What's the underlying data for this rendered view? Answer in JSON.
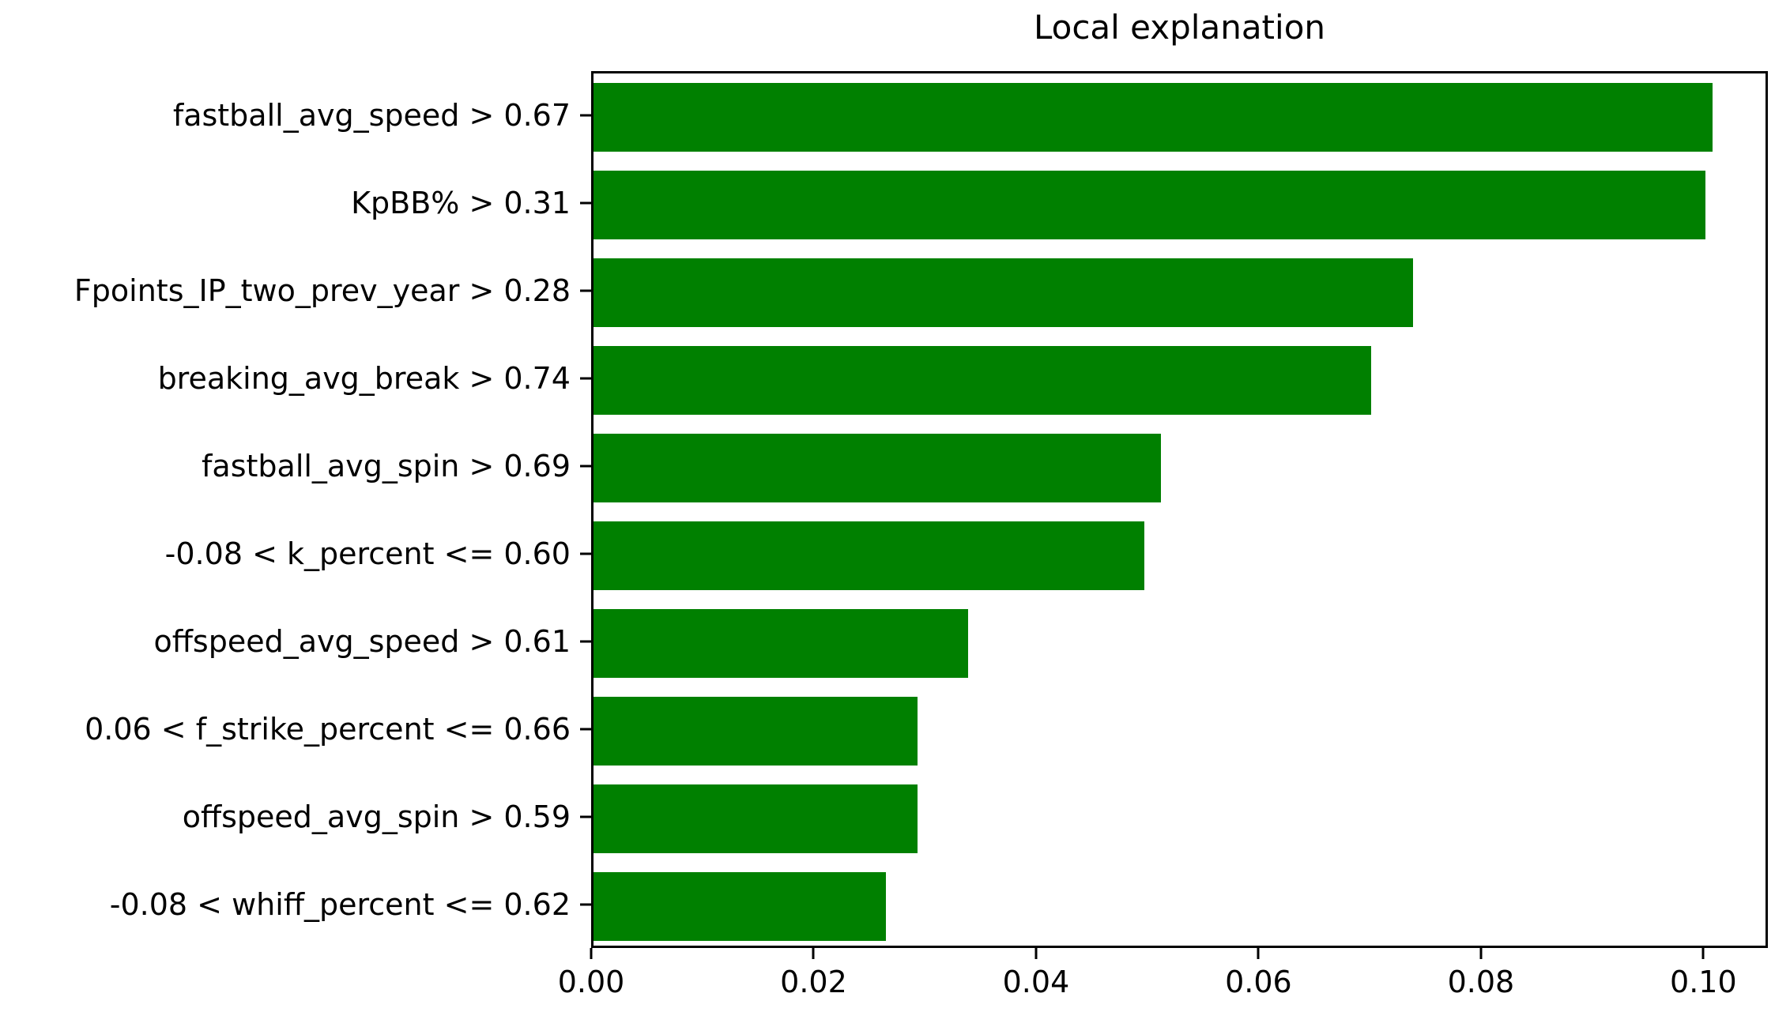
{
  "chart_data": {
    "type": "bar",
    "orientation": "horizontal",
    "title": "Local explanation",
    "xlabel": "",
    "ylabel": "",
    "categories": [
      "fastball_avg_speed > 0.67",
      "KpBB% > 0.31",
      "Fpoints_IP_two_prev_year > 0.28",
      "breaking_avg_break > 0.74",
      "fastball_avg_spin > 0.69",
      "-0.08 < k_percent <= 0.60",
      "offspeed_avg_speed > 0.61",
      "0.06 < f_strike_percent <= 0.66",
      "offspeed_avg_spin > 0.59",
      "-0.08 < whiff_percent <= 0.62"
    ],
    "values": [
      0.1006,
      0.1,
      0.0737,
      0.0699,
      0.051,
      0.0495,
      0.0337,
      0.0291,
      0.0291,
      0.0263
    ],
    "bar_color": "#008000",
    "xlim": [
      0.0,
      0.1058
    ],
    "xticks": [
      0.0,
      0.02,
      0.04,
      0.06,
      0.08,
      0.1
    ],
    "xtick_labels": [
      "0.00",
      "0.02",
      "0.04",
      "0.06",
      "0.08",
      "0.10"
    ],
    "grid": false,
    "legend": null
  }
}
